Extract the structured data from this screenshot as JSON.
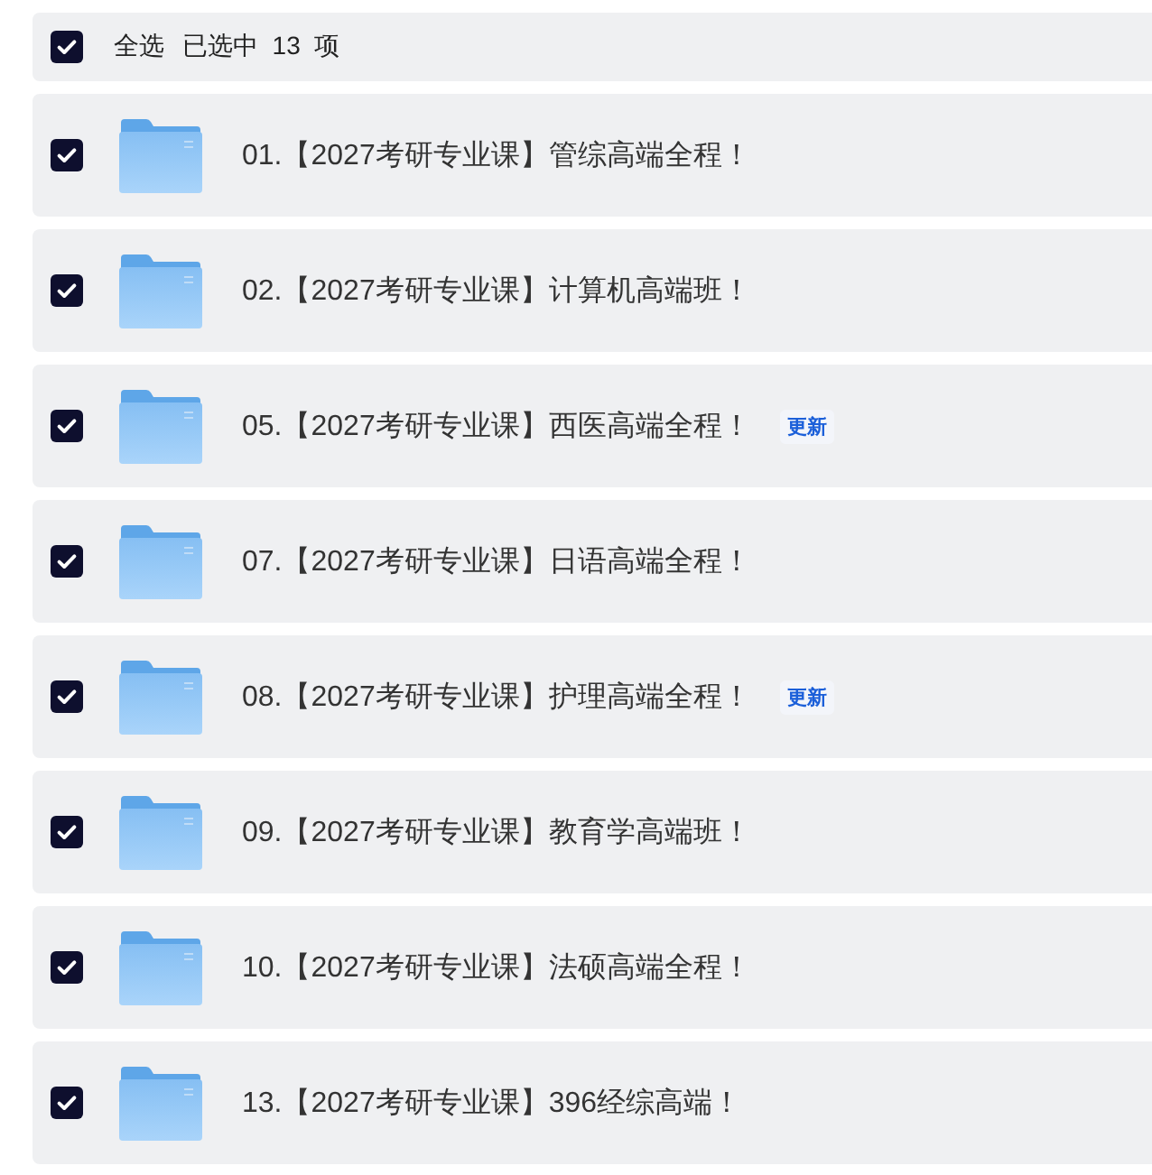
{
  "header": {
    "checked": true,
    "select_all_label": "全选",
    "selected_count_text": "已选中  13  项"
  },
  "folders": [
    {
      "name": "01.【2027考研专业课】管综高端全程！",
      "checked": true
    },
    {
      "name": "02.【2027考研专业课】计算机高端班！",
      "checked": true
    },
    {
      "name": "05.【2027考研专业课】西医高端全程！",
      "checked": true,
      "badge": "更新"
    },
    {
      "name": "07.【2027考研专业课】日语高端全程！",
      "checked": true
    },
    {
      "name": "08.【2027考研专业课】护理高端全程！",
      "checked": true,
      "badge": "更新"
    },
    {
      "name": "09.【2027考研专业课】教育学高端班！",
      "checked": true
    },
    {
      "name": "10.【2027考研专业课】法硕高端全程！",
      "checked": true
    },
    {
      "name": "13.【2027考研专业课】396经综高端！",
      "checked": true
    }
  ]
}
